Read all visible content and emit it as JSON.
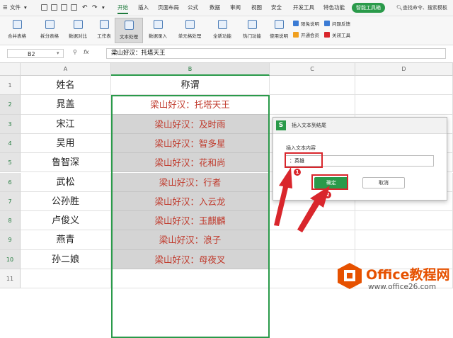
{
  "menubar": {
    "file_label": "文件",
    "tabs": [
      "开始",
      "插入",
      "页面布局",
      "公式",
      "数据",
      "审阅",
      "视图",
      "安全",
      "开发工具",
      "特色功能",
      "智能工具箱"
    ],
    "search_label": "查找命令、搜索模板"
  },
  "ribbon": {
    "buttons": [
      "合并表格",
      "拆分表格",
      "数据对比",
      "工作表",
      "文本处理",
      "数据录入",
      "单元格处理",
      "全新功能",
      "热门功能",
      "使用说明"
    ],
    "small": [
      "限免说明",
      "开通会员",
      "问题反馈",
      "关闭工具"
    ]
  },
  "formula_bar": {
    "cell_ref": "B2",
    "fx": "fx",
    "content": "梁山好汉：托塔天王"
  },
  "sheet": {
    "columns": [
      "A",
      "B",
      "C",
      "D"
    ],
    "rows": [
      "1",
      "2",
      "3",
      "4",
      "5",
      "6",
      "7",
      "8",
      "9",
      "10",
      "11"
    ],
    "header_name": "姓名",
    "header_nick": "称谓",
    "names": [
      "晁盖",
      "宋江",
      "吴用",
      "鲁智深",
      "武松",
      "公孙胜",
      "卢俊义",
      "燕青",
      "孙二娘"
    ],
    "nicknames": [
      "梁山好汉：托塔天王",
      "梁山好汉：及时雨",
      "梁山好汉：智多星",
      "梁山好汉：花和尚",
      "梁山好汉：行者",
      "梁山好汉：入云龙",
      "梁山好汉：玉麒麟",
      "梁山好汉：浪子",
      "梁山好汉：母夜叉"
    ]
  },
  "dialog": {
    "logo": "S",
    "title": "插入文本到结尾",
    "prompt": "插入文本内容",
    "input_value": "：英雄",
    "ok_label": "确定",
    "cancel_label": "取消"
  },
  "annotations": {
    "step1": "1",
    "step2": "2"
  },
  "watermark": {
    "title": "Office教程网",
    "url": "www.office26.com"
  },
  "colors": {
    "accent": "#2a9a4a",
    "highlight": "#d9262c",
    "nick_text": "#c0392b",
    "watermark": "#e65100"
  }
}
